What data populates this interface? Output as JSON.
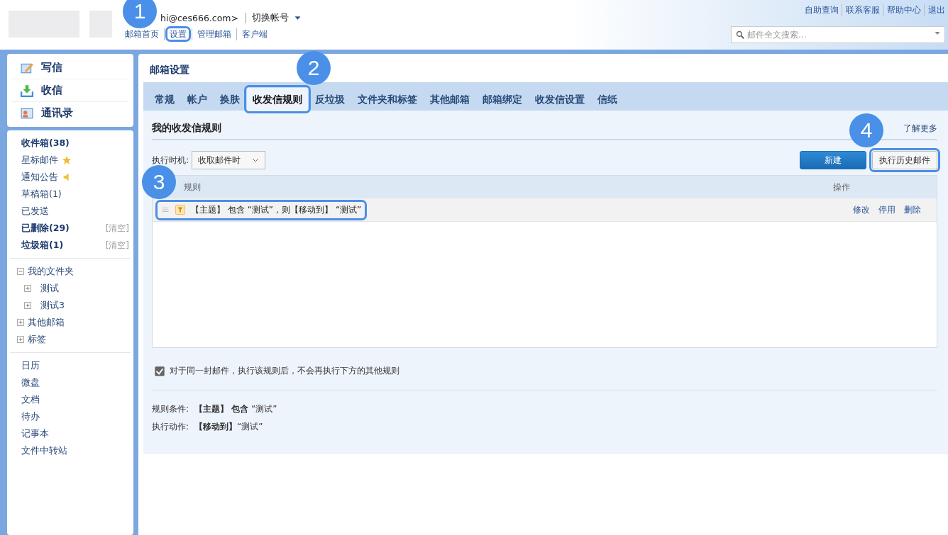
{
  "header": {
    "account": "hi@ces666.com>",
    "switch_account": "切换帐号",
    "links": [
      {
        "label": "邮箱首页",
        "highlighted": false
      },
      {
        "label": "设置",
        "highlighted": true,
        "callout": "1"
      },
      {
        "label": "管理邮箱",
        "highlighted": false
      },
      {
        "label": "客户端",
        "highlighted": false
      }
    ],
    "top_links": [
      "自助查询",
      "联系客服",
      "帮助中心",
      "退出"
    ],
    "search": {
      "placeholder": "邮件全文搜索..."
    }
  },
  "sidebar": {
    "actions": [
      {
        "label": "写信",
        "kind": "compose"
      },
      {
        "label": "收信",
        "kind": "receive"
      },
      {
        "label": "通讯录",
        "kind": "contacts"
      }
    ],
    "folders": [
      {
        "label": "收件箱(38)",
        "bold": true
      },
      {
        "label": "星标邮件",
        "bold": false,
        "kind": "star"
      },
      {
        "label": "通知公告",
        "bold": false,
        "kind": "notice"
      },
      {
        "label": "草稿箱(1)",
        "bold": false
      },
      {
        "label": "已发送",
        "bold": false
      },
      {
        "label": "已删除(29)",
        "bold": true,
        "action": "[清空]"
      },
      {
        "label": "垃圾箱(1)",
        "bold": true,
        "action": "[清空]"
      }
    ],
    "tree": [
      {
        "label": "我的文件夹",
        "expanded": true,
        "children": [
          {
            "label": "测试",
            "expanded": false
          },
          {
            "label": "测试3",
            "expanded": false
          }
        ]
      },
      {
        "label": "其他邮箱",
        "expanded": false
      },
      {
        "label": "标签",
        "expanded": false
      }
    ],
    "apps": [
      "日历",
      "微盘",
      "文档",
      "待办",
      "记事本",
      "文件中转站"
    ]
  },
  "main": {
    "title": "邮箱设置",
    "tabs": [
      {
        "label": "常规",
        "selected": false,
        "highlighted": false
      },
      {
        "label": "帐户",
        "selected": false,
        "highlighted": false
      },
      {
        "label": "换肤",
        "selected": false,
        "highlighted": false
      },
      {
        "label": "收发信规则",
        "selected": true,
        "highlighted": true,
        "callout": "2"
      },
      {
        "label": "反垃圾",
        "selected": false,
        "highlighted": false
      },
      {
        "label": "文件夹和标签",
        "selected": false,
        "highlighted": false
      },
      {
        "label": "其他邮箱",
        "selected": false,
        "highlighted": false
      },
      {
        "label": "邮箱绑定",
        "selected": false,
        "highlighted": false
      },
      {
        "label": "收发信设置",
        "selected": false,
        "highlighted": false
      },
      {
        "label": "信纸",
        "selected": false,
        "highlighted": false
      }
    ],
    "section_title": "我的收发信规则",
    "learn_more": "了解更多",
    "timing": {
      "label": "执行时机:",
      "value": "收取邮件时"
    },
    "buttons": [
      {
        "label": "新建",
        "kind": "primary",
        "highlighted": false
      },
      {
        "label": "执行历史邮件",
        "kind": "secondary",
        "highlighted": true,
        "callout": "4"
      }
    ],
    "table": {
      "callout": "3",
      "columns": [
        "规则",
        "操作"
      ],
      "rows": [
        {
          "rule": "【主题】 包含 “测试”，则【移动到】 “测试”",
          "highlighted": true,
          "actions": [
            "修改",
            "停用",
            "删除"
          ]
        }
      ]
    },
    "stop_option": {
      "label": "对于同一封邮件，执行该规则后，不会再执行下方的其他规则",
      "checked": true
    },
    "details": [
      {
        "label": "规则条件:",
        "value": "**【主题】 包含** “测试”"
      },
      {
        "label": "执行动作:",
        "value": "**【移动到】**“测试”"
      }
    ]
  }
}
